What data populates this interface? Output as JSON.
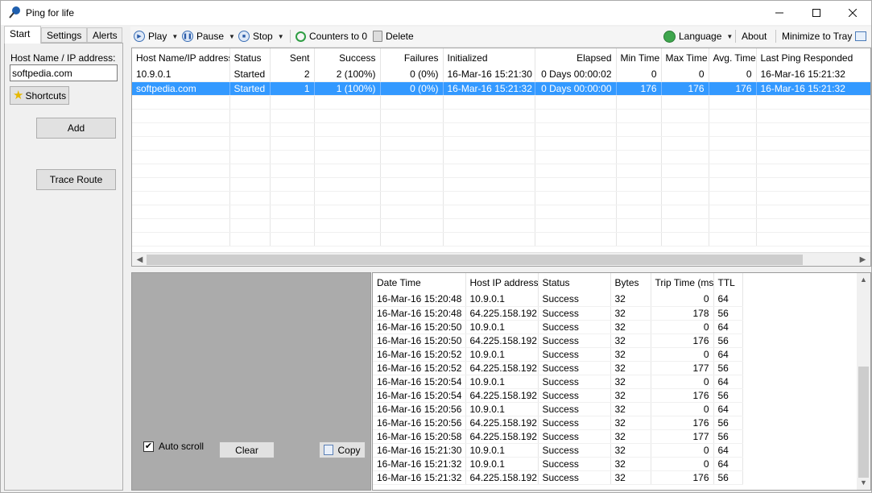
{
  "window": {
    "title": "Ping for life"
  },
  "tabs": [
    {
      "label": "Start"
    },
    {
      "label": "Settings"
    },
    {
      "label": "Alerts"
    }
  ],
  "left": {
    "host_label": "Host Name / IP address:",
    "host_value": "softpedia.com",
    "shortcuts_label": "Shortcuts",
    "add_label": "Add",
    "trace_label": "Trace Route"
  },
  "toolbar": {
    "play": "Play",
    "pause": "Pause",
    "stop": "Stop",
    "counters": "Counters to 0",
    "delete": "Delete",
    "language": "Language",
    "about": "About",
    "minimize": "Minimize to Tray"
  },
  "hosts": {
    "columns": [
      "Host Name/IP address",
      "Status",
      "Sent",
      "Success",
      "Failures",
      "Initialized",
      "Elapsed",
      "Min Time",
      "Max Time",
      "Avg. Time",
      "Last Ping Responded"
    ],
    "rows": [
      [
        "10.9.0.1",
        "Started",
        "2",
        "2 (100%)",
        "0 (0%)",
        "16-Mar-16 15:21:30",
        "0 Days 00:00:02",
        "0",
        "0",
        "0",
        "16-Mar-16 15:21:32"
      ],
      [
        "softpedia.com",
        "Started",
        "1",
        "1 (100%)",
        "0 (0%)",
        "16-Mar-16 15:21:32",
        "0 Days 00:00:00",
        "176",
        "176",
        "176",
        "16-Mar-16 15:21:32"
      ]
    ],
    "selected_row": 1
  },
  "log_controls": {
    "autoscroll_label": "Auto scroll",
    "autoscroll_checked": true,
    "clear_label": "Clear",
    "copy_label": "Copy"
  },
  "log": {
    "columns": [
      "Date Time",
      "Host IP address",
      "Status",
      "Bytes",
      "Trip Time (ms)",
      "TTL"
    ],
    "rows": [
      [
        "16-Mar-16 15:20:48",
        "10.9.0.1",
        "Success",
        "32",
        "0",
        "64"
      ],
      [
        "16-Mar-16 15:20:48",
        "64.225.158.192",
        "Success",
        "32",
        "178",
        "56"
      ],
      [
        "16-Mar-16 15:20:50",
        "10.9.0.1",
        "Success",
        "32",
        "0",
        "64"
      ],
      [
        "16-Mar-16 15:20:50",
        "64.225.158.192",
        "Success",
        "32",
        "176",
        "56"
      ],
      [
        "16-Mar-16 15:20:52",
        "10.9.0.1",
        "Success",
        "32",
        "0",
        "64"
      ],
      [
        "16-Mar-16 15:20:52",
        "64.225.158.192",
        "Success",
        "32",
        "177",
        "56"
      ],
      [
        "16-Mar-16 15:20:54",
        "10.9.0.1",
        "Success",
        "32",
        "0",
        "64"
      ],
      [
        "16-Mar-16 15:20:54",
        "64.225.158.192",
        "Success",
        "32",
        "176",
        "56"
      ],
      [
        "16-Mar-16 15:20:56",
        "10.9.0.1",
        "Success",
        "32",
        "0",
        "64"
      ],
      [
        "16-Mar-16 15:20:56",
        "64.225.158.192",
        "Success",
        "32",
        "176",
        "56"
      ],
      [
        "16-Mar-16 15:20:58",
        "64.225.158.192",
        "Success",
        "32",
        "177",
        "56"
      ],
      [
        "16-Mar-16 15:21:30",
        "10.9.0.1",
        "Success",
        "32",
        "0",
        "64"
      ],
      [
        "16-Mar-16 15:21:32",
        "10.9.0.1",
        "Success",
        "32",
        "0",
        "64"
      ],
      [
        "16-Mar-16 15:21:32",
        "64.225.158.192",
        "Success",
        "32",
        "176",
        "56"
      ]
    ]
  },
  "colors": {
    "selection": "#3399ff",
    "log_panel_bg": "#ababab"
  }
}
